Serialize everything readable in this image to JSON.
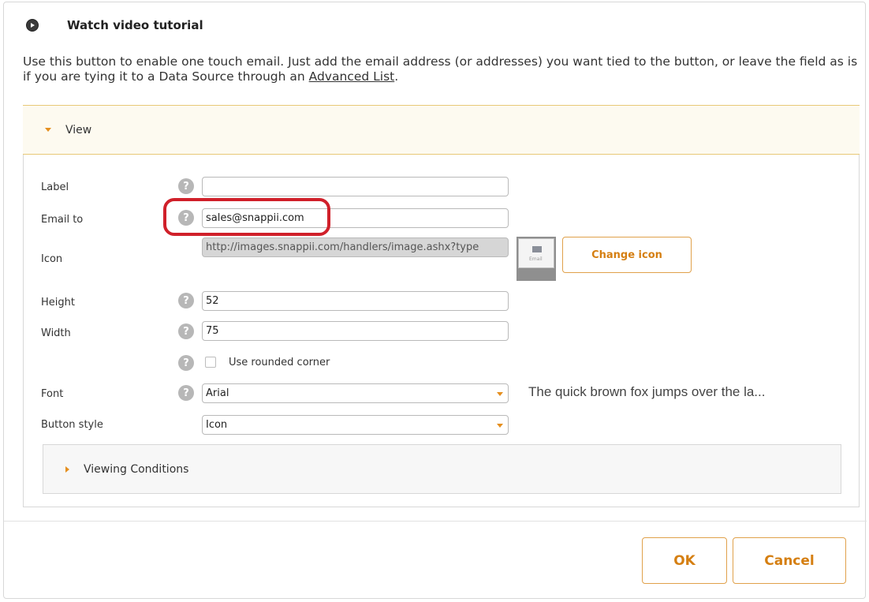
{
  "header": {
    "tutorial_label": "Watch video tutorial"
  },
  "intro": {
    "text_before": "Use this button to enable one touch email. Just add the email address (or addresses) you want tied to the button, or leave the field as is if you are tying it to a Data Source through an ",
    "link_text": "Advanced List",
    "text_after": "."
  },
  "view_panel": {
    "title": "View",
    "fields": {
      "label": {
        "label": "Label",
        "value": ""
      },
      "email_to": {
        "label": "Email to",
        "value": "sales@snappii.com"
      },
      "icon": {
        "label": "Icon",
        "value": "http://images.snappii.com/handlers/image.ashx?type"
      },
      "height": {
        "label": "Height",
        "value": "52"
      },
      "width": {
        "label": "Width",
        "value": "75"
      },
      "rounded_corner": {
        "label": "Use rounded corner",
        "checked": false
      },
      "font": {
        "label": "Font",
        "value": "Arial"
      },
      "button_style": {
        "label": "Button style",
        "value": "Icon"
      }
    },
    "icon_thumb_caption": "Email",
    "change_icon_label": "Change icon",
    "font_preview": "The quick brown fox jumps over the la...",
    "help_glyph": "?"
  },
  "viewing_conditions": {
    "title": "Viewing Conditions"
  },
  "footer": {
    "ok_label": "OK",
    "cancel_label": "Cancel"
  },
  "colors": {
    "accent_orange": "#d57f12",
    "highlight_red": "#d0202a",
    "panel_header_bg": "#fdfaf0"
  }
}
